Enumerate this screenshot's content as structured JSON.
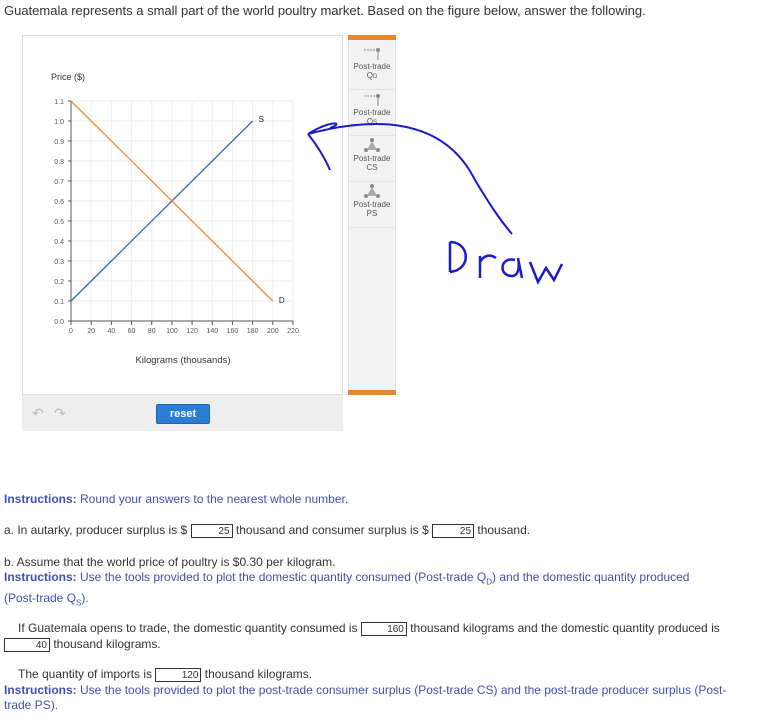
{
  "intro_text": "Guatemala represents a small part of the world poultry market. Based on the figure below, answer the following.",
  "chart_data": {
    "type": "line",
    "ylabel": "Price ($)",
    "xlabel": "Kilograms (thousands)",
    "x_ticks": [
      "0",
      "20",
      "40",
      "60",
      "80",
      "100",
      "120",
      "140",
      "160",
      "180",
      "200",
      "220"
    ],
    "y_ticks": [
      "0.0",
      "0.1",
      "0.2",
      "0.3",
      "0.4",
      "0.5",
      "0.6",
      "0.7",
      "0.8",
      "0.9",
      "1.0",
      "1.1"
    ],
    "xlim": [
      0,
      220
    ],
    "ylim": [
      0,
      1.1
    ],
    "grid": true,
    "series": [
      {
        "name": "S",
        "color": "#3366bb",
        "x": [
          0,
          180
        ],
        "y": [
          0.1,
          1.0
        ]
      },
      {
        "name": "D",
        "color": "#ee8833",
        "x": [
          0,
          200
        ],
        "y": [
          1.1,
          0.1
        ]
      }
    ]
  },
  "toolbox": [
    {
      "label": "Post-trade",
      "sub": "Q",
      "subscript": "D",
      "icon": "line-tool-icon"
    },
    {
      "label": "Post-trade",
      "sub": "Q",
      "subscript": "S",
      "icon": "line-tool-icon"
    },
    {
      "label": "Post-trade",
      "sub": "CS",
      "subscript": "",
      "icon": "polygon-tool-icon"
    },
    {
      "label": "Post-trade",
      "sub": "PS",
      "subscript": "",
      "icon": "polygon-tool-icon"
    }
  ],
  "controls": {
    "reset_label": "reset"
  },
  "annotation": {
    "text": "Draw",
    "color": "#1a1acc"
  },
  "instructions": {
    "label": "Instructions:",
    "round": "Round your answers to the nearest whole number.",
    "tools_qty": "Use the tools provided to plot the domestic quantity consumed (Post-trade Q",
    "tools_qty_2": ") and the domestic quantity produced",
    "tools_qty_3": "(Post-trade Q",
    "tools_qty_4": ").",
    "tools_surplus": "Use the tools provided to plot the post-trade consumer surplus (Post-trade CS) and the post-trade producer surplus (Post-",
    "tools_surplus_2": "trade PS)."
  },
  "question_a": {
    "prefix": "a. In autarky, producer surplus is $",
    "ps_value": "25",
    "middle": "thousand and consumer surplus is $",
    "cs_value": "25",
    "suffix": "thousand."
  },
  "question_b": {
    "text": "b. Assume that the world price of poultry is $0.30 per kilogram.",
    "line1_prefix": "If Guatemala opens to trade, the domestic quantity consumed is",
    "consumed_value": "160",
    "line1_middle": "thousand kilograms and the domestic quantity produced is",
    "produced_value": "40",
    "line2_suffix": "thousand kilograms.",
    "imports_prefix": "The quantity of imports is",
    "imports_value": "120",
    "imports_suffix": "thousand kilograms."
  }
}
